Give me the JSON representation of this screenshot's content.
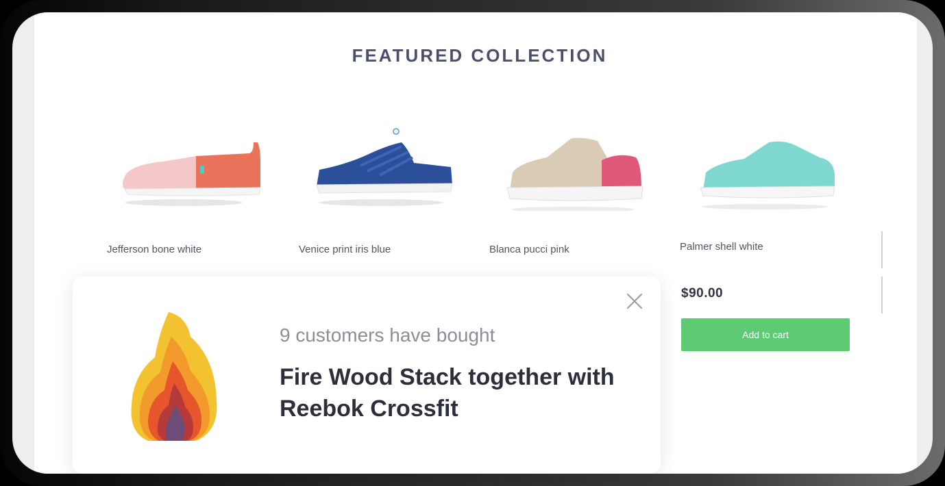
{
  "section": {
    "title": "FEATURED COLLECTION"
  },
  "products": [
    {
      "name": "Jefferson bone  white",
      "image": "slip-on-shoe-pink-coral"
    },
    {
      "name": "Venice print iris blue",
      "image": "sandal-shoe-blue"
    },
    {
      "name": "Blanca pucci pink",
      "image": "sneaker-shoe-beige-pink"
    },
    {
      "name": "Palmer shell white",
      "image": "sneaker-shoe-mint",
      "price": "$90.00",
      "cta": "Add to cart"
    }
  ],
  "popup": {
    "subtitle": "9 customers have bought",
    "message": "Fire Wood Stack together with Reebok Crossfit",
    "close_icon": "close-icon",
    "image_icon": "flame-stack-icon"
  },
  "colors": {
    "accent_green": "#5dcb73",
    "title": "#4a4f6b"
  }
}
